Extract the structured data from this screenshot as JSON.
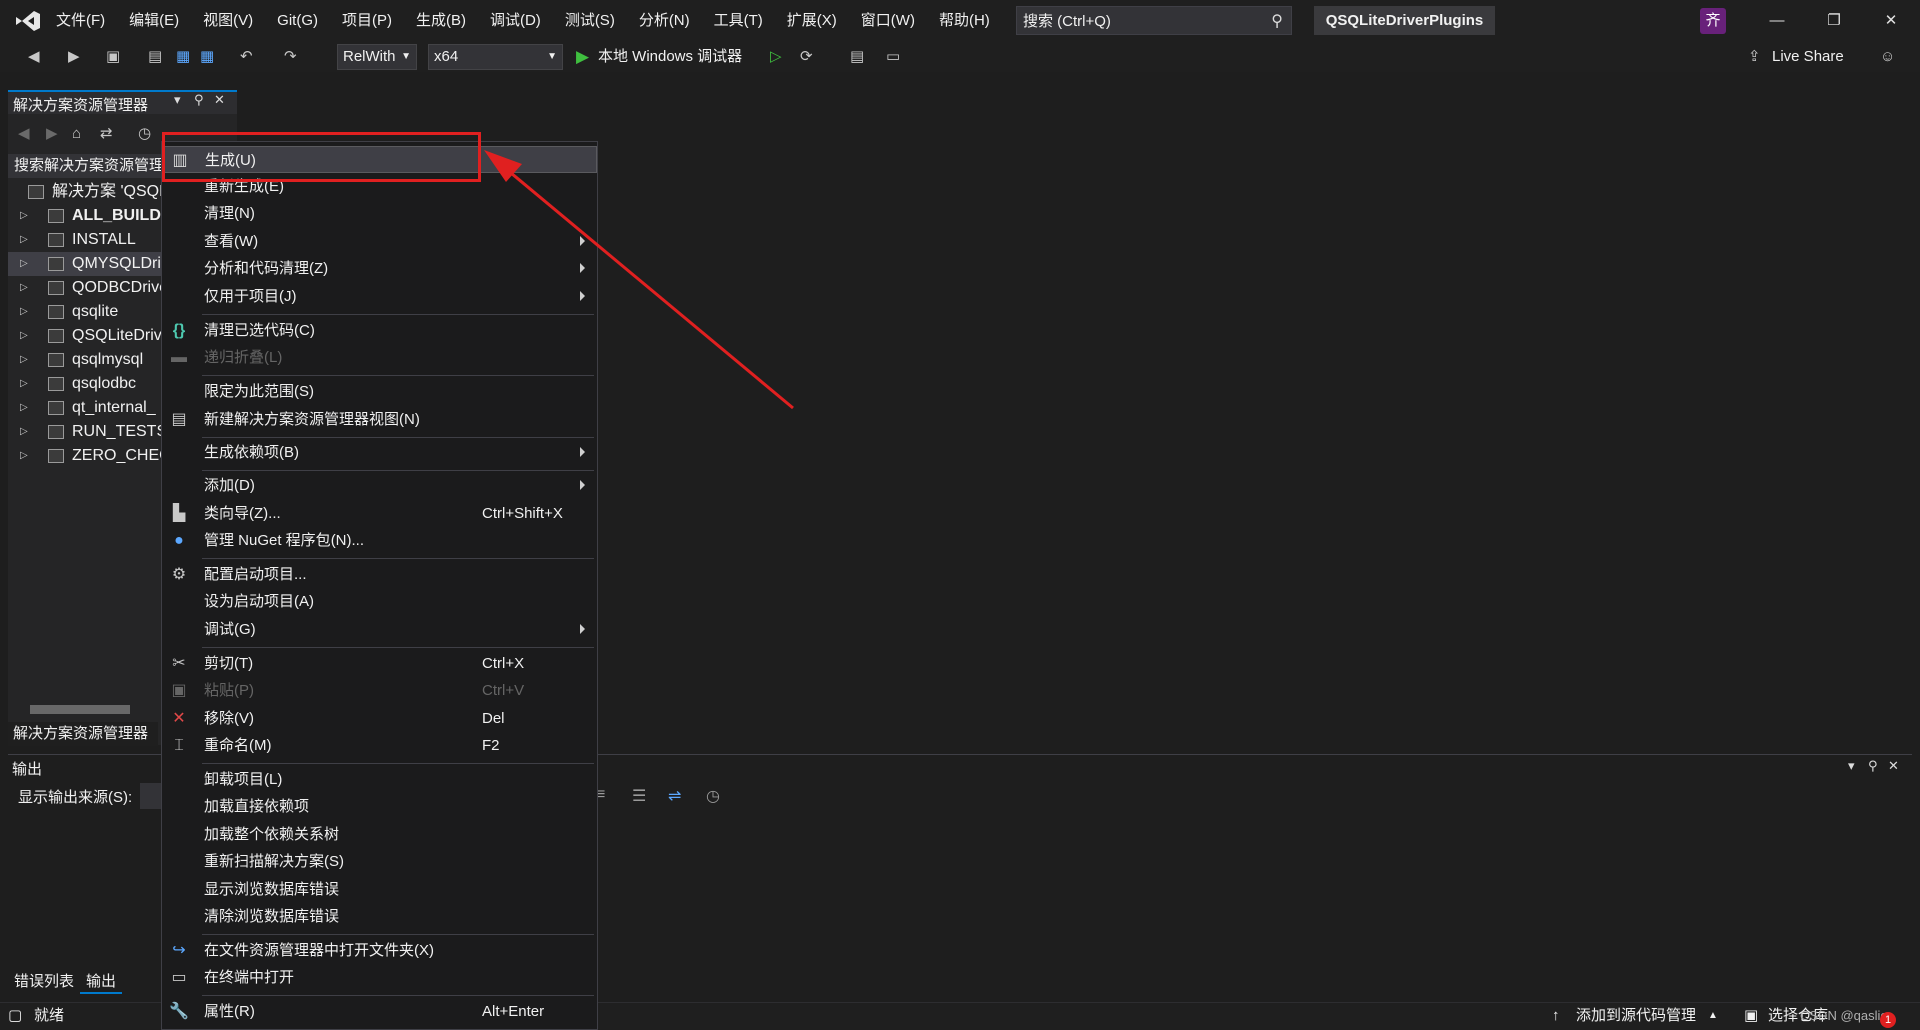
{
  "menubar": {
    "items": [
      "文件(F)",
      "编辑(E)",
      "视图(V)",
      "Git(G)",
      "项目(P)",
      "生成(B)",
      "调试(D)",
      "测试(S)",
      "分析(N)",
      "工具(T)",
      "扩展(X)",
      "窗口(W)",
      "帮助(H)"
    ],
    "search_placeholder": "搜索 (Ctrl+Q)",
    "project_title": "QSQLiteDriverPlugins",
    "avatar_initial": "齐"
  },
  "toolbar": {
    "config": "RelWith",
    "platform": "x64",
    "debugger": "本地 Windows 调试器",
    "live_share": "Live Share"
  },
  "solution_explorer": {
    "title": "解决方案资源管理器",
    "search_placeholder": "搜索解决方案资源管理器",
    "tree": [
      {
        "label": "解决方案 'QSQL",
        "type": "solution"
      },
      {
        "label": "ALL_BUILD",
        "bold": true
      },
      {
        "label": "INSTALL"
      },
      {
        "label": "QMYSQLDri",
        "selected": true
      },
      {
        "label": "QODBCDrive"
      },
      {
        "label": "qsqlite"
      },
      {
        "label": "QSQLiteDriv"
      },
      {
        "label": "qsqlmysql"
      },
      {
        "label": "qsqlodbc"
      },
      {
        "label": "qt_internal_"
      },
      {
        "label": "RUN_TESTS"
      },
      {
        "label": "ZERO_CHEC"
      }
    ],
    "bottom_tab": "解决方案资源管理器"
  },
  "output": {
    "title": "输出",
    "source_label": "显示输出来源(S):"
  },
  "bottom_tabs": [
    "错误列表",
    "输出"
  ],
  "status": {
    "ready": "就绪",
    "add_to_source_control": "添加到源代码管理",
    "select_repo": "选择仓库",
    "watermark": "CSDN @qaslic",
    "notification_count": "1"
  },
  "context_menu": {
    "items": [
      {
        "label": "生成(U)",
        "icon": "build-icon"
      },
      {
        "label": "重新生成(E)"
      },
      {
        "label": "清理(N)"
      },
      {
        "label": "查看(W)",
        "submenu": true
      },
      {
        "label": "分析和代码清理(Z)",
        "submenu": true
      },
      {
        "label": "仅用于项目(J)",
        "submenu": true
      },
      {
        "label": "清理已选代码(C)",
        "icon": "braces-icon"
      },
      {
        "label": "递归折叠(L)",
        "disabled": true,
        "icon": "collapse-icon"
      },
      {
        "label": "限定为此范围(S)"
      },
      {
        "label": "新建解决方案资源管理器视图(N)",
        "icon": "new-view-icon"
      },
      {
        "label": "生成依赖项(B)",
        "submenu": true
      },
      {
        "label": "添加(D)",
        "submenu": true
      },
      {
        "label": "类向导(Z)...",
        "shortcut": "Ctrl+Shift+X",
        "icon": "class-wizard-icon"
      },
      {
        "label": "管理 NuGet 程序包(N)...",
        "icon": "nuget-icon"
      },
      {
        "label": "配置启动项目...",
        "icon": "gear-icon"
      },
      {
        "label": "设为启动项目(A)"
      },
      {
        "label": "调试(G)",
        "submenu": true
      },
      {
        "label": "剪切(T)",
        "shortcut": "Ctrl+X",
        "icon": "scissors-icon"
      },
      {
        "label": "粘贴(P)",
        "shortcut": "Ctrl+V",
        "disabled": true,
        "icon": "paste-icon"
      },
      {
        "label": "移除(V)",
        "shortcut": "Del",
        "icon": "remove-icon"
      },
      {
        "label": "重命名(M)",
        "shortcut": "F2",
        "icon": "rename-icon"
      },
      {
        "label": "卸载项目(L)"
      },
      {
        "label": "加载直接依赖项"
      },
      {
        "label": "加载整个依赖关系树"
      },
      {
        "label": "重新扫描解决方案(S)"
      },
      {
        "label": "显示浏览数据库错误"
      },
      {
        "label": "清除浏览数据库错误"
      },
      {
        "label": "在文件资源管理器中打开文件夹(X)",
        "icon": "open-folder-icon"
      },
      {
        "label": "在终端中打开",
        "icon": "terminal-icon"
      },
      {
        "label": "属性(R)",
        "shortcut": "Alt+Enter",
        "icon": "wrench-icon"
      }
    ]
  },
  "colors": {
    "accent": "#007acc",
    "annotation": "#e02020",
    "background": "#1e1e1e"
  }
}
